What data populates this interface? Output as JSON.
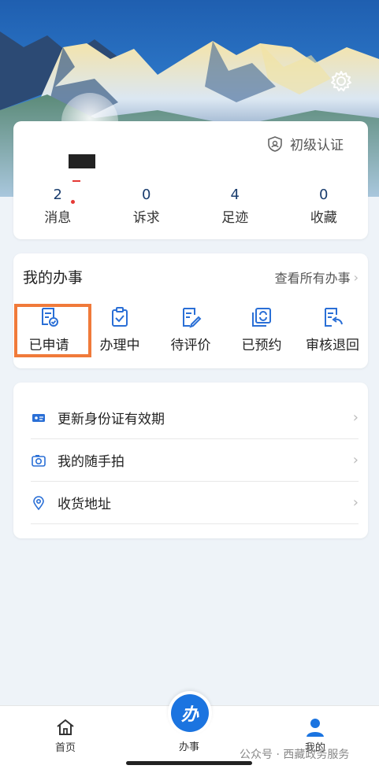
{
  "profile": {
    "auth_label": "初级认证",
    "stats": [
      {
        "num": "2",
        "label": "消息"
      },
      {
        "num": "0",
        "label": "诉求"
      },
      {
        "num": "4",
        "label": "足迹"
      },
      {
        "num": "0",
        "label": "收藏"
      }
    ]
  },
  "work": {
    "title": "我的办事",
    "more": "查看所有办事",
    "items": [
      {
        "label": "已申请",
        "icon": "applied-icon"
      },
      {
        "label": "办理中",
        "icon": "processing-icon"
      },
      {
        "label": "待评价",
        "icon": "to-review-icon"
      },
      {
        "label": "已预约",
        "icon": "booked-icon"
      },
      {
        "label": "审核退回",
        "icon": "returned-icon"
      }
    ]
  },
  "list": [
    {
      "label": "更新身份证有效期",
      "icon": "id-card-icon"
    },
    {
      "label": "我的随手拍",
      "icon": "camera-icon"
    },
    {
      "label": "收货地址",
      "icon": "location-icon"
    }
  ],
  "tabbar": {
    "home": "首页",
    "work": "办事",
    "center_glyph": "办",
    "mine": "我的"
  },
  "watermark": "公众号 · 西藏政务服务",
  "colors": {
    "accent": "#1b74e0",
    "highlight": "#f07a3a",
    "badge": "#e53935"
  }
}
